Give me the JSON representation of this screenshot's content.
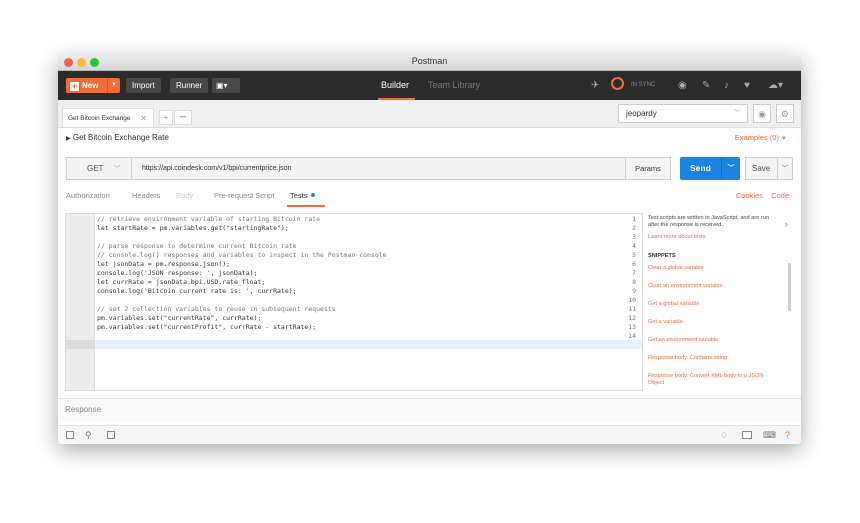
{
  "window": {
    "title": "Postman"
  },
  "header": {
    "new_label": "New",
    "import_label": "Import",
    "runner_label": "Runner",
    "tabs": [
      {
        "label": "Builder"
      },
      {
        "label": "Team Library"
      }
    ],
    "sync_label": "IN SYNC"
  },
  "tab": {
    "name": "Get Bitcoin Exchange",
    "more": "•••"
  },
  "environment": {
    "selected": "jeopardy"
  },
  "request": {
    "name": "Get Bitcoin Exchange Rate",
    "examples": "Examples (0)",
    "method": "GET",
    "url": "https://api.coindesk.com/v1/bpi/currentprice.json",
    "params_label": "Params",
    "send_label": "Send",
    "save_label": "Save"
  },
  "subtabs": {
    "items": [
      {
        "label": "Authorization"
      },
      {
        "label": "Headers"
      },
      {
        "label": "Body"
      },
      {
        "label": "Pre-request Script"
      },
      {
        "label": "Tests"
      }
    ],
    "cookies": "Cookies",
    "code": "Code"
  },
  "editor": {
    "line_numbers": [
      "1",
      "2",
      "3",
      "4",
      "5",
      "6",
      "7",
      "8",
      "9",
      "10",
      "11",
      "12",
      "13",
      "14"
    ],
    "lines": [
      "// retrieve environment variable of starting Bitcoin rate",
      "let startRate = pm.variables.get(\"startingRate\");",
      "",
      "// parse response to determine current Bitcoin rate",
      "// console.log() responses and variables to inspect in the Postman console",
      "let jsonData = pm.response.json();",
      "console.log('JSON response: ', jsonData);",
      "let currRate = jsonData.bpi.USD.rate_float;",
      "console.log('Bitcoin current rate is: ', currRate);",
      "",
      "// set 2 collection variables to reuse in subsequent requests",
      "pm.variables.set(\"currentRate\", currRate);",
      "pm.variables.set(\"currentProfit\", currRate - startRate);",
      ""
    ]
  },
  "sidebar": {
    "description": "Test scripts are written in JavaScript, and are run after the response is received.",
    "learn_more": "Learn more about tests",
    "snippets_heading": "SNIPPETS",
    "snippets": [
      "Clear a global variable",
      "Clear an environment variable",
      "Get a global variable",
      "Get a variable",
      "Get an environment variable",
      "Response body: Contains string",
      "Response body: Convert XML body to a JSON Object"
    ]
  },
  "response": {
    "label": "Response"
  },
  "colors": {
    "accent": "#f26b3a",
    "send": "#1a84e4",
    "header_bg": "#2b2b2b"
  }
}
